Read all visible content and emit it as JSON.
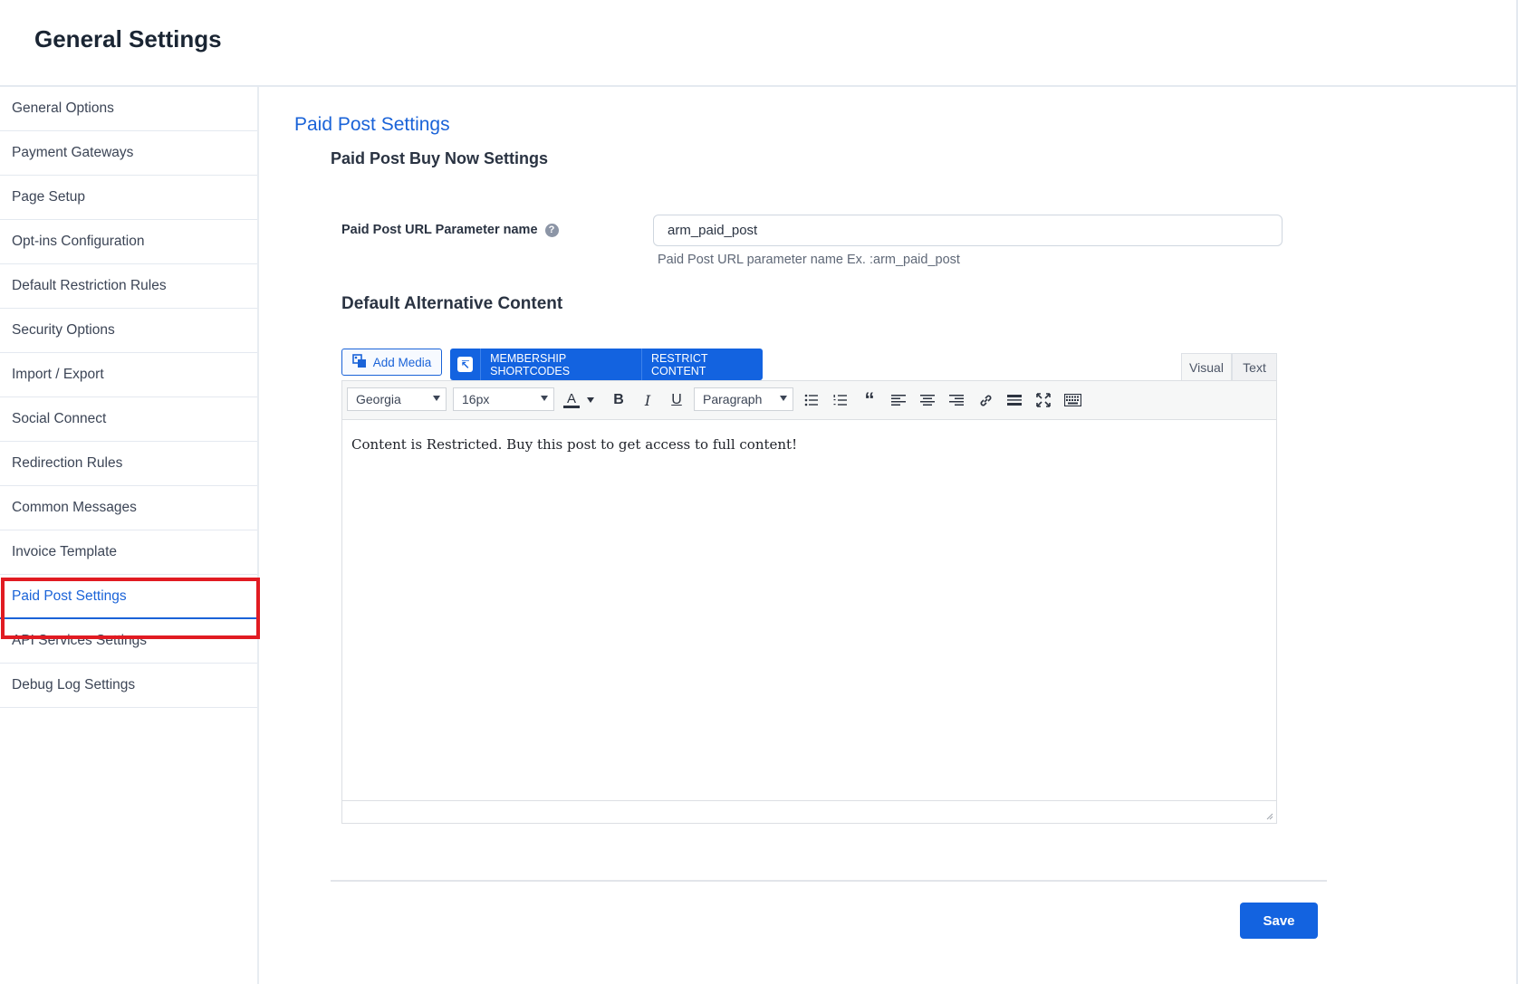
{
  "page": {
    "title": "General Settings"
  },
  "sidebar": {
    "items": [
      {
        "label": "General Options"
      },
      {
        "label": "Payment Gateways"
      },
      {
        "label": "Page Setup"
      },
      {
        "label": "Opt-ins Configuration"
      },
      {
        "label": "Default Restriction Rules"
      },
      {
        "label": "Security Options"
      },
      {
        "label": "Import / Export"
      },
      {
        "label": "Social Connect"
      },
      {
        "label": "Redirection Rules"
      },
      {
        "label": "Common Messages"
      },
      {
        "label": "Invoice Template"
      },
      {
        "label": "Paid Post Settings",
        "active": true
      },
      {
        "label": "API Services Settings"
      },
      {
        "label": "Debug Log Settings"
      }
    ]
  },
  "main": {
    "section_title": "Paid Post Settings",
    "section_subtitle": "Paid Post Buy Now Settings",
    "url_param": {
      "label": "Paid Post URL Parameter name",
      "help_icon": "question-circle-icon",
      "value": "arm_paid_post",
      "hint": "Paid Post URL parameter name Ex. :arm_paid_post"
    },
    "alt_content": {
      "title": "Default Alternative Content",
      "add_media_label": "Add Media",
      "membership_shortcodes_label": "MEMBERSHIP SHORTCODES",
      "restrict_content_label": "RESTRICT CONTENT",
      "tabs": {
        "visual": "Visual",
        "text": "Text"
      },
      "font_family": "Georgia",
      "font_size": "16px",
      "format": "Paragraph",
      "content": "Content is Restricted. Buy this post to get access to full content!"
    },
    "save_label": "Save"
  },
  "colors": {
    "accent": "#1363e0",
    "highlight": "#e11b22",
    "active_text": "#1a63d8"
  }
}
